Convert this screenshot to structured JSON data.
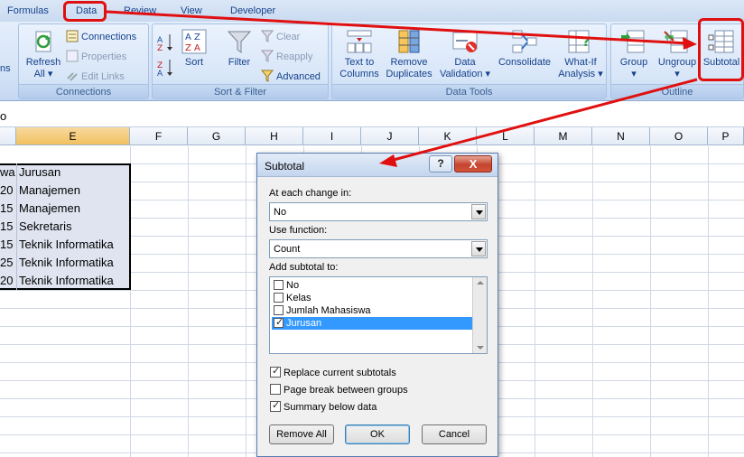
{
  "tabs": [
    "Formulas",
    "Data",
    "Review",
    "View",
    "Developer"
  ],
  "ribbon": {
    "connections": {
      "refresh_label": "Refresh",
      "refresh_sub": "All ▾",
      "connections_label": "Connections",
      "properties_label": "Properties",
      "edit_links_label": "Edit Links",
      "group_label": "Connections"
    },
    "sort_filter": {
      "sort_label": "Sort",
      "filter_label": "Filter",
      "clear_label": "Clear",
      "reapply_label": "Reapply",
      "advanced_label": "Advanced",
      "group_label": "Sort & Filter"
    },
    "data_tools": {
      "text_to_columns_1": "Text to",
      "text_to_columns_2": "Columns",
      "remove_duplicates_1": "Remove",
      "remove_duplicates_2": "Duplicates",
      "data_validation_1": "Data",
      "data_validation_2": "Validation ▾",
      "consolidate_label": "Consolidate",
      "whatif_1": "What-If",
      "whatif_2": "Analysis ▾",
      "group_label": "Data Tools"
    },
    "outline": {
      "group_btn": "Group",
      "group_btn_sub": "▾",
      "ungroup_btn": "Ungroup",
      "ungroup_btn_sub": "▾",
      "subtotal_btn": "Subtotal",
      "group_label": "Outline",
      "left_edge": "ns"
    }
  },
  "formula_bar": {
    "value": "o"
  },
  "columns": [
    "E",
    "F",
    "G",
    "H",
    "I",
    "J",
    "K",
    "L",
    "M",
    "N",
    "O",
    "P"
  ],
  "rows": [
    {
      "d": "wa",
      "e": "Jurusan"
    },
    {
      "d": "20",
      "e": "Manajemen"
    },
    {
      "d": "15",
      "e": "Manajemen"
    },
    {
      "d": "15",
      "e": "Sekretaris"
    },
    {
      "d": "15",
      "e": "Teknik Informatika"
    },
    {
      "d": "25",
      "e": "Teknik Informatika"
    },
    {
      "d": "20",
      "e": "Teknik Informatika"
    }
  ],
  "dialog": {
    "title": "Subtotal",
    "help": "?",
    "close": "X",
    "change_label": "At each change in:",
    "change_value": "No",
    "function_label": "Use function:",
    "function_value": "Count",
    "add_label": "Add subtotal to:",
    "fields": [
      {
        "label": "No",
        "checked": false
      },
      {
        "label": "Kelas",
        "checked": false
      },
      {
        "label": "Jumlah Mahasiswa",
        "checked": false
      },
      {
        "label": "Jurusan",
        "checked": true
      }
    ],
    "replace_label": "Replace current subtotals",
    "pagebreak_label": "Page break between groups",
    "summary_label": "Summary below data",
    "remove_all": "Remove All",
    "ok": "OK",
    "cancel": "Cancel"
  }
}
